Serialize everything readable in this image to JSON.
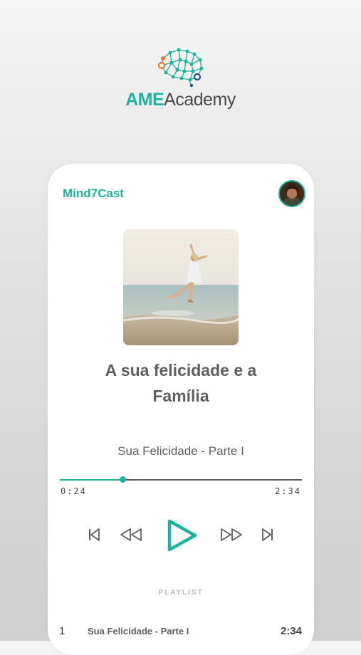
{
  "brand": {
    "name_part1": "AME",
    "name_part2": "Academy"
  },
  "header": {
    "title": "Mind7Cast"
  },
  "player": {
    "track_title_line1": "A sua felicidade e a",
    "track_title_line2": "Família",
    "episode_title": "Sua Felicidade - Parte I",
    "elapsed": "0:24",
    "duration": "2:34",
    "progress_fraction": 0.26
  },
  "controls": {
    "icons": [
      "skip-previous-icon",
      "rewind-icon",
      "play-icon",
      "fast-forward-icon",
      "skip-next-icon"
    ]
  },
  "playlist": {
    "label": "PLAYLIST",
    "items": [
      {
        "number": "1",
        "title": "Sua Felicidade - Parte I",
        "duration": "2:34"
      }
    ]
  },
  "colors": {
    "accent": "#1fb39c",
    "text": "#5f5f5f",
    "playlist_label": "#b4b7cc",
    "background": "#dcdcdc"
  }
}
